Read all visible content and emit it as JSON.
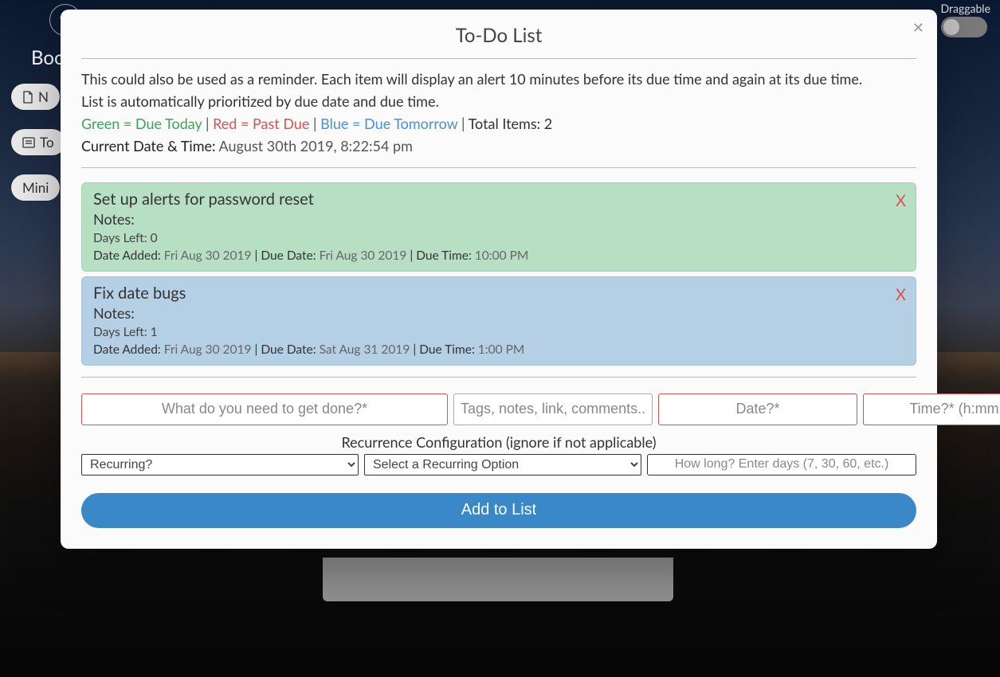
{
  "brand": "Boo",
  "background_buttons": {
    "new": "N",
    "todo": "To",
    "mini": "Mini"
  },
  "draggable": {
    "label": "Draggable",
    "on": false
  },
  "modal": {
    "title": "To-Do List",
    "intro_line1": "This could also be used as a reminder. Each item will display an alert 10 minutes before its due time and again at its due time.",
    "intro_line2": "List is automatically prioritized by due date and due time.",
    "legend": {
      "green": "Green = Due Today",
      "red": "Red = Past Due",
      "blue": "Blue = Due Tomorrow",
      "total_label": "Total Items:",
      "total_value": "2"
    },
    "current": {
      "label": "Current Date & Time:",
      "value": "August 30th 2019, 8:22:54 pm"
    },
    "items": [
      {
        "color": "green",
        "title": "Set up alerts for password reset",
        "notes_label": "Notes:",
        "notes_value": "",
        "days_left_label": "Days Left:",
        "days_left_value": "0",
        "date_added_label": "Date Added:",
        "date_added_value": "Fri Aug 30 2019",
        "due_date_label": "Due Date:",
        "due_date_value": "Fri Aug 30 2019",
        "due_time_label": "Due Time:",
        "due_time_value": "10:00 PM"
      },
      {
        "color": "blue",
        "title": "Fix date bugs",
        "notes_label": "Notes:",
        "notes_value": "",
        "days_left_label": "Days Left:",
        "days_left_value": "1",
        "date_added_label": "Date Added:",
        "date_added_value": "Fri Aug 30 2019",
        "due_date_label": "Due Date:",
        "due_date_value": "Sat Aug 31 2019",
        "due_time_label": "Due Time:",
        "due_time_value": "1:00 PM"
      }
    ],
    "inputs": {
      "task_placeholder": "What do you need to get done?*",
      "notes_placeholder": "Tags, notes, link, comments...",
      "date_placeholder": "Date?*",
      "time_placeholder": "Time?* (h:mm p)"
    },
    "recurrence": {
      "heading": "Recurrence Configuration (ignore if not applicable)",
      "recurring_selected": "Recurring?",
      "option_selected": "Select a Recurring Option",
      "howlong_placeholder": "How long? Enter days (7, 30, 60, etc.)"
    },
    "add_button": "Add to List",
    "delete_glyph": "X"
  }
}
